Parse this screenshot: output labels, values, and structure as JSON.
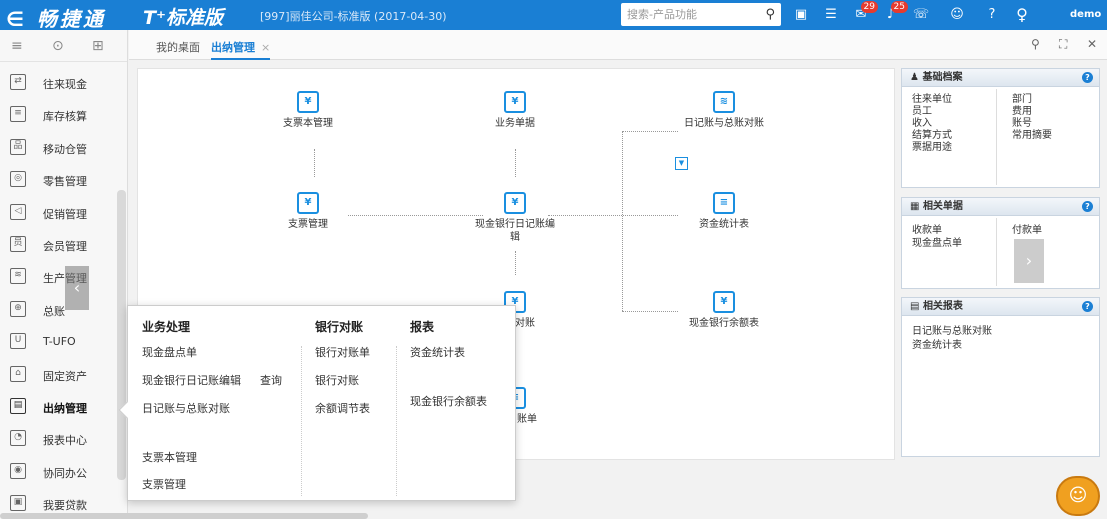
{
  "app": {
    "brand": "畅捷通",
    "edition": "T⁺标准版",
    "company": "[997]丽佳公司-标准版  (2017-04-30)",
    "search_placeholder": "搜索-产品功能",
    "user": "demo",
    "badge_msgs": "29",
    "badge_alerts": "25",
    "back_glyph": "∈"
  },
  "sidebar": {
    "items": [
      {
        "label": "往来现金",
        "icon": "⇄"
      },
      {
        "label": "库存核算",
        "icon": "≡"
      },
      {
        "label": "移动仓管",
        "icon": "品"
      },
      {
        "label": "零售管理",
        "icon": "◎"
      },
      {
        "label": "促销管理",
        "icon": "◁"
      },
      {
        "label": "会员管理",
        "icon": "员"
      },
      {
        "label": "生产管理",
        "icon": "≋"
      },
      {
        "label": "总账",
        "icon": "⊕"
      },
      {
        "label": "T-UFO",
        "icon": "U"
      },
      {
        "label": "固定资产",
        "icon": "⌂"
      },
      {
        "label": "出纳管理",
        "icon": "▤"
      },
      {
        "label": "报表中心",
        "icon": "◔"
      },
      {
        "label": "协同办公",
        "icon": "◉"
      },
      {
        "label": "我要贷款",
        "icon": "▣"
      }
    ],
    "collapse_glyph": "‹"
  },
  "tabs": [
    {
      "label": "我的桌面"
    },
    {
      "label": "出纳管理",
      "close": "×"
    }
  ],
  "flow": {
    "nodes": [
      {
        "label": "支票本管理",
        "icon": "¥"
      },
      {
        "label": "业务单据",
        "icon": "¥"
      },
      {
        "label": "日记账与总账对账",
        "icon": "≋"
      },
      {
        "label": "支票管理",
        "icon": "¥"
      },
      {
        "label": "现金银行日记账编辑",
        "icon": "¥"
      },
      {
        "label": "资金统计表",
        "icon": "≡"
      },
      {
        "label": "现金银行余额表",
        "icon": "¥"
      },
      {
        "label": "对账",
        "icon": "¥"
      },
      {
        "label": "账单",
        "icon": "≡"
      }
    ],
    "dropdown_glyph": "▼"
  },
  "panels": {
    "basic": {
      "title": "基础档案",
      "help": "?",
      "col1": [
        "往来单位",
        "员工",
        "收入",
        "结算方式",
        "票据用途"
      ],
      "col2": [
        "部门",
        "费用",
        "账号",
        "常用摘要"
      ]
    },
    "docs": {
      "title": "相关单据",
      "help": "?",
      "col1": [
        "收款单",
        "现金盘点单"
      ],
      "col2": [
        "付款单"
      ],
      "next": "›"
    },
    "reports": {
      "title": "相关报表",
      "help": "?",
      "items": [
        "日记账与总账对账",
        "资金统计表"
      ]
    }
  },
  "popup": {
    "headers": [
      "业务处理",
      "银行对账",
      "报表"
    ],
    "col1": [
      "现金盘点单",
      "现金银行日记账编辑",
      "日记账与总账对账",
      "支票本管理",
      "支票管理"
    ],
    "col1_extra": "查询",
    "col2": [
      "银行对账单",
      "银行对账",
      "余额调节表"
    ],
    "col3": [
      "资金统计表",
      "现金银行余额表"
    ]
  }
}
